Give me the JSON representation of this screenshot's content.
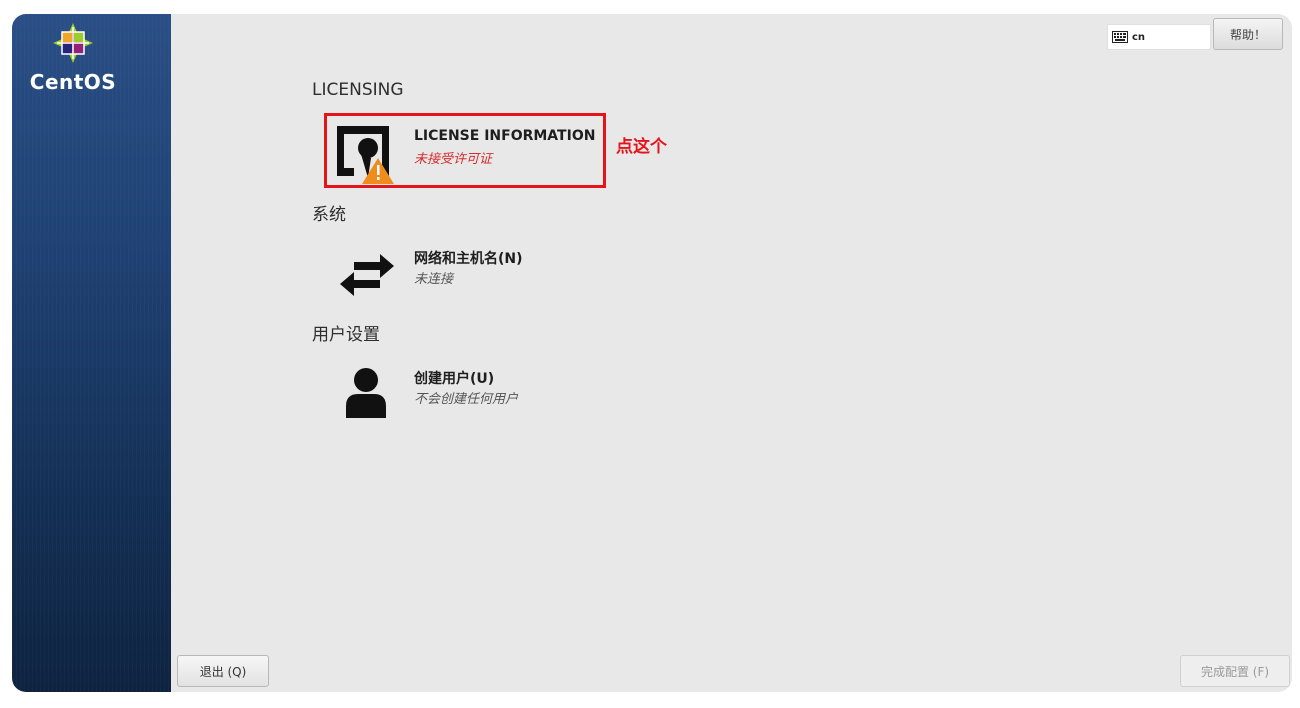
{
  "sidebar": {
    "brand": "CentOS",
    "logo_icon": "centos-logo-icon"
  },
  "header": {
    "keyboard_layout": "cn",
    "help_label": "帮助！"
  },
  "sections": [
    {
      "title": "LICENSING",
      "spokes": [
        {
          "icon": "license-warning-icon",
          "title": "LICENSE INFORMATION",
          "status": "未接受许可证",
          "status_color": "#d62b2b"
        }
      ]
    },
    {
      "title": "系统",
      "spokes": [
        {
          "icon": "network-arrows-icon",
          "title": "网络和主机名(N)",
          "status": "未连接"
        }
      ]
    },
    {
      "title": "用户设置",
      "spokes": [
        {
          "icon": "user-icon",
          "title": "创建用户(U)",
          "status": "不会创建任何用户"
        }
      ]
    }
  ],
  "annotation": {
    "text": "点这个",
    "color": "#e5141a"
  },
  "footer": {
    "quit_label": "退出 (Q)",
    "finish_label": "完成配置 (F)"
  },
  "colors": {
    "sidebar_top": "#2a4f86",
    "sidebar_bottom": "#0e2340",
    "background": "#e8e8e8",
    "warning": "#f08c1e"
  }
}
